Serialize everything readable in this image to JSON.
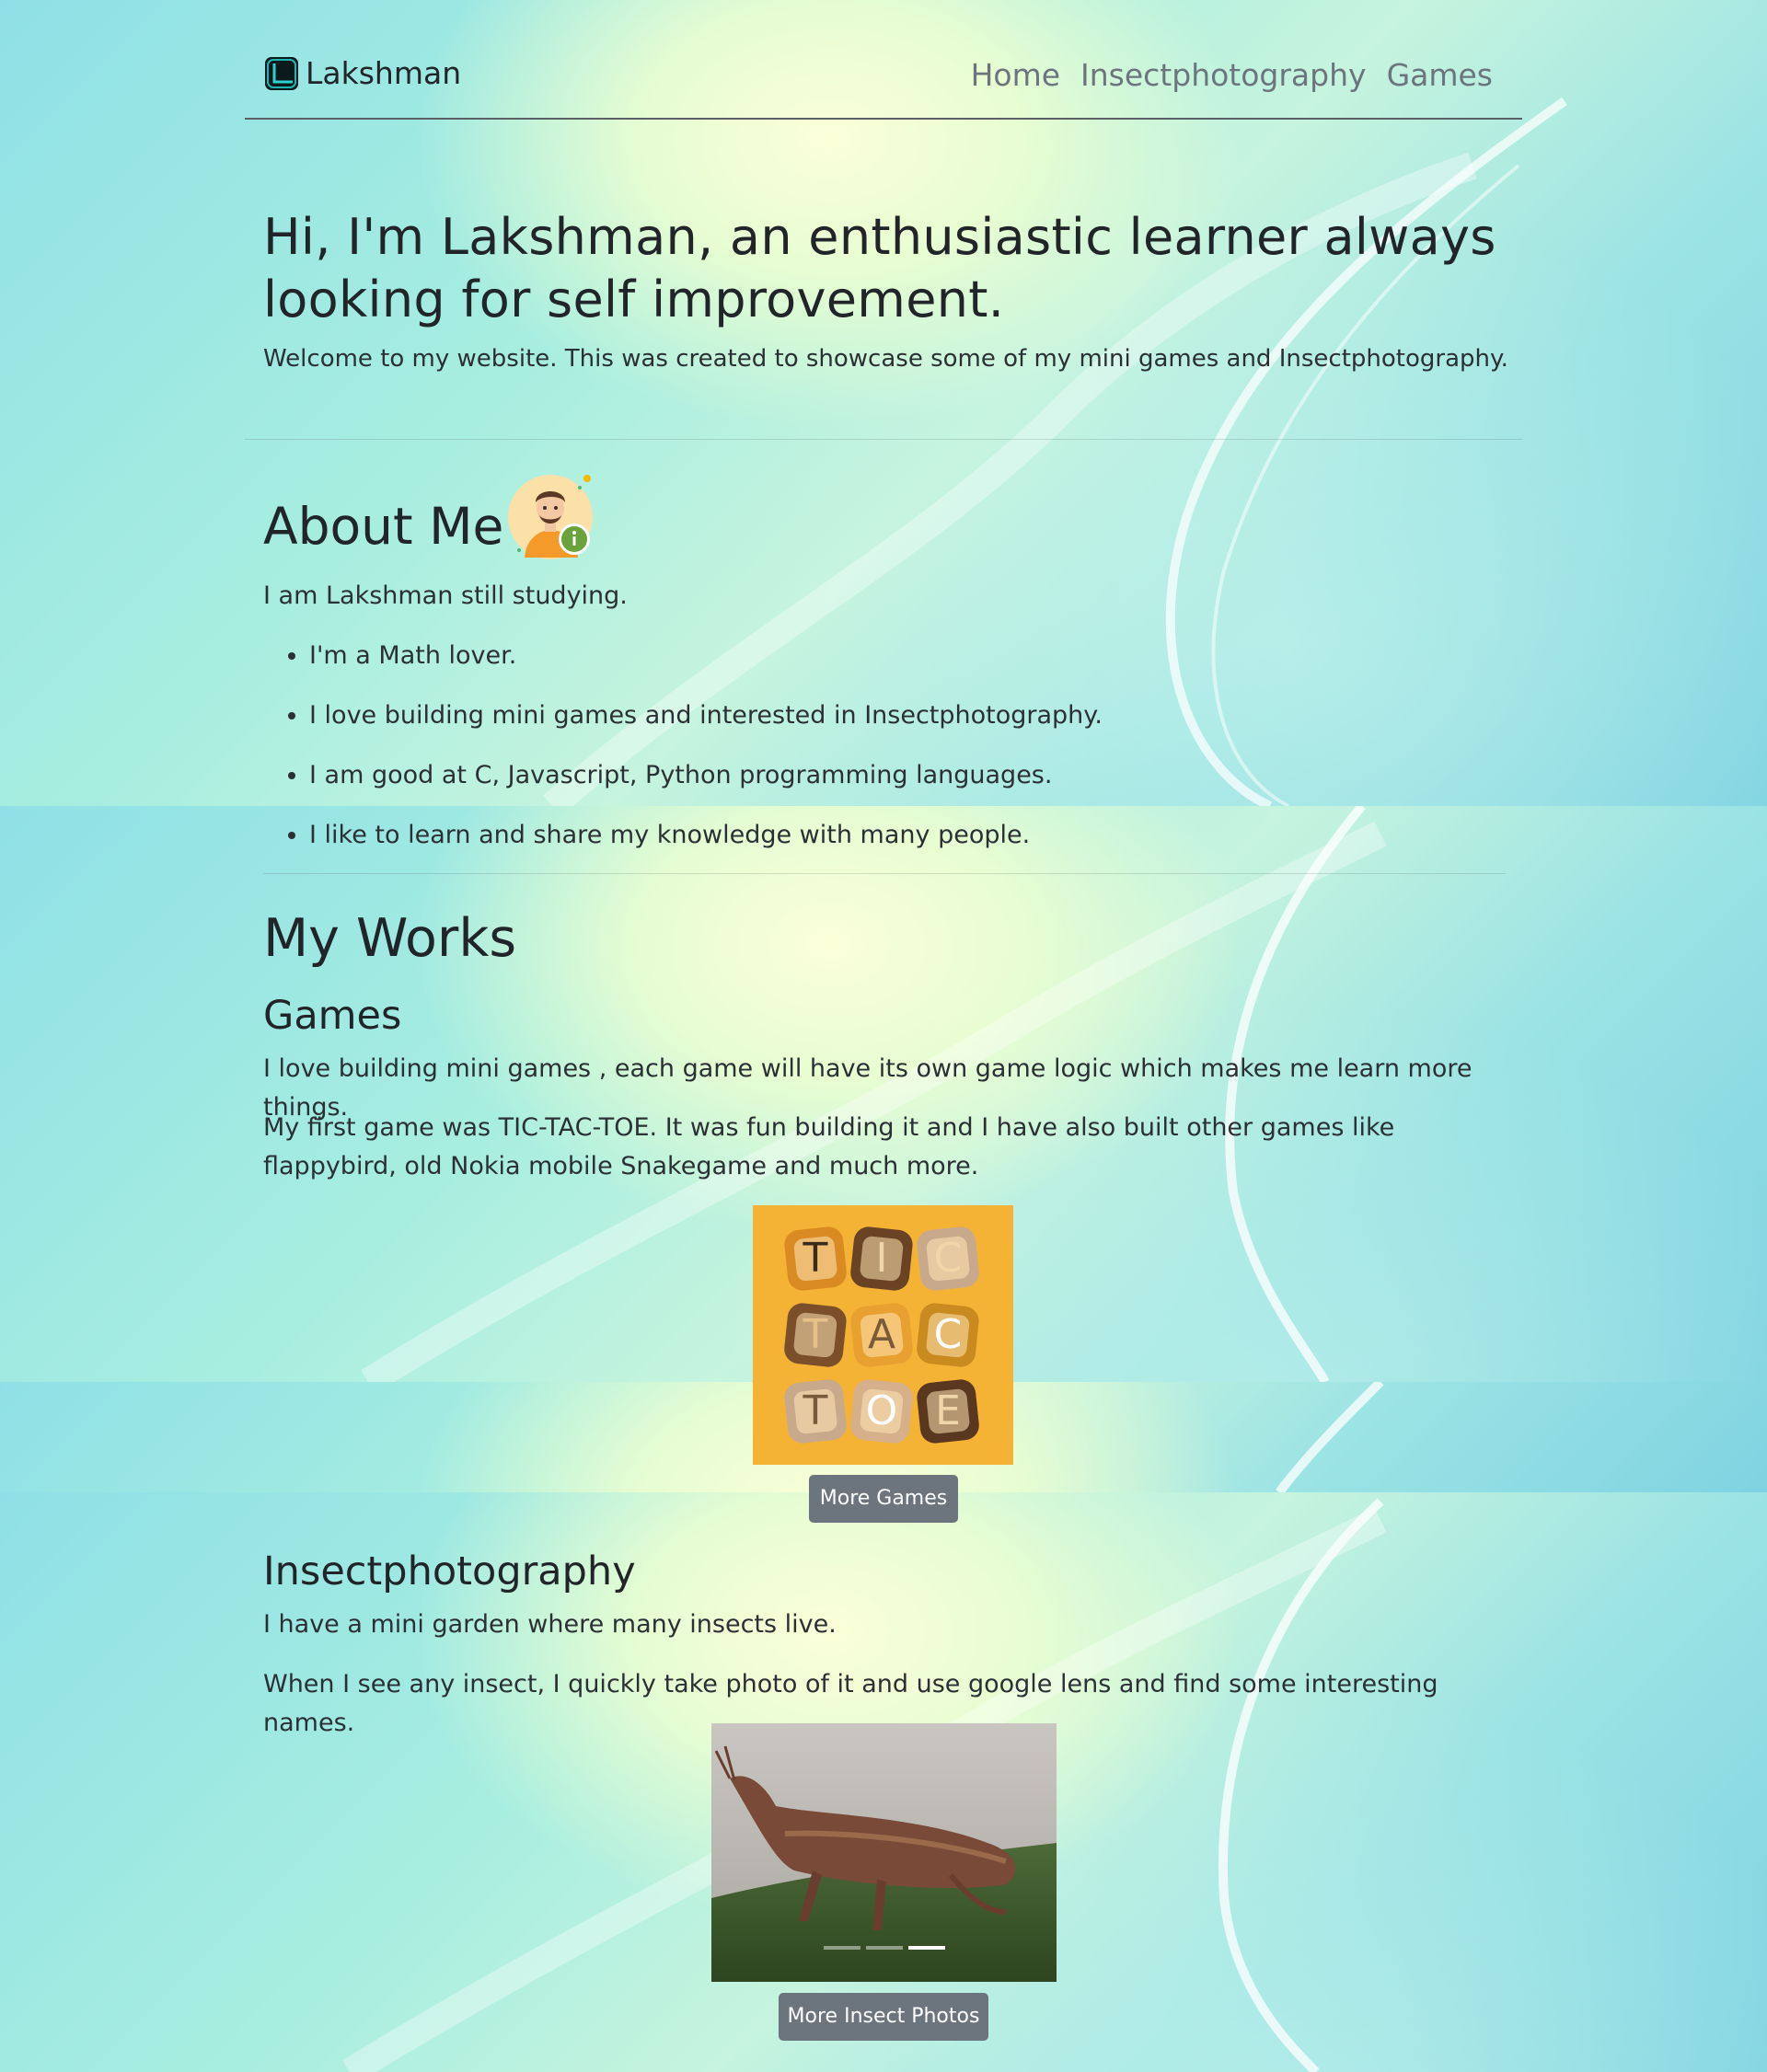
{
  "nav": {
    "brand": "Lakshman",
    "links": [
      "Home",
      "Insectphotography",
      "Games"
    ]
  },
  "hero": {
    "title": "Hi, I'm Lakshman, an enthusiastic learner always looking for self improvement.",
    "lead": "Welcome to my website. This was created to showcase some of my mini games and Insectphotography."
  },
  "about": {
    "title": "About Me",
    "intro": "I am Lakshman still studying.",
    "items": [
      "I'm a Math lover.",
      "I love building mini games and interested in Insectphotography.",
      "I am good at C, Javascript, Python programming languages.",
      "I like to learn and share my knowledge with many people."
    ]
  },
  "works": {
    "title": "My Works",
    "games": {
      "title": "Games",
      "p1": "I love building mini games , each game will have its own game logic which makes me learn more things.",
      "p2": "My first game was TIC-TAC-TOE. It was fun building it and I have also built other games like flappybird, old Nokia mobile Snakegame and much more.",
      "tiles": [
        "T",
        "I",
        "C",
        "T",
        "A",
        "C",
        "T",
        "O",
        "E"
      ],
      "button": "More Games"
    },
    "insects": {
      "title": "Insectphotography",
      "p1": "I have a mini garden where many insects live.",
      "p2": "When I see any insect, I quickly take photo of it and use google lens and find some interesting names.",
      "button": "More Insect Photos",
      "slide_count": 3,
      "active_slide": 3
    }
  }
}
